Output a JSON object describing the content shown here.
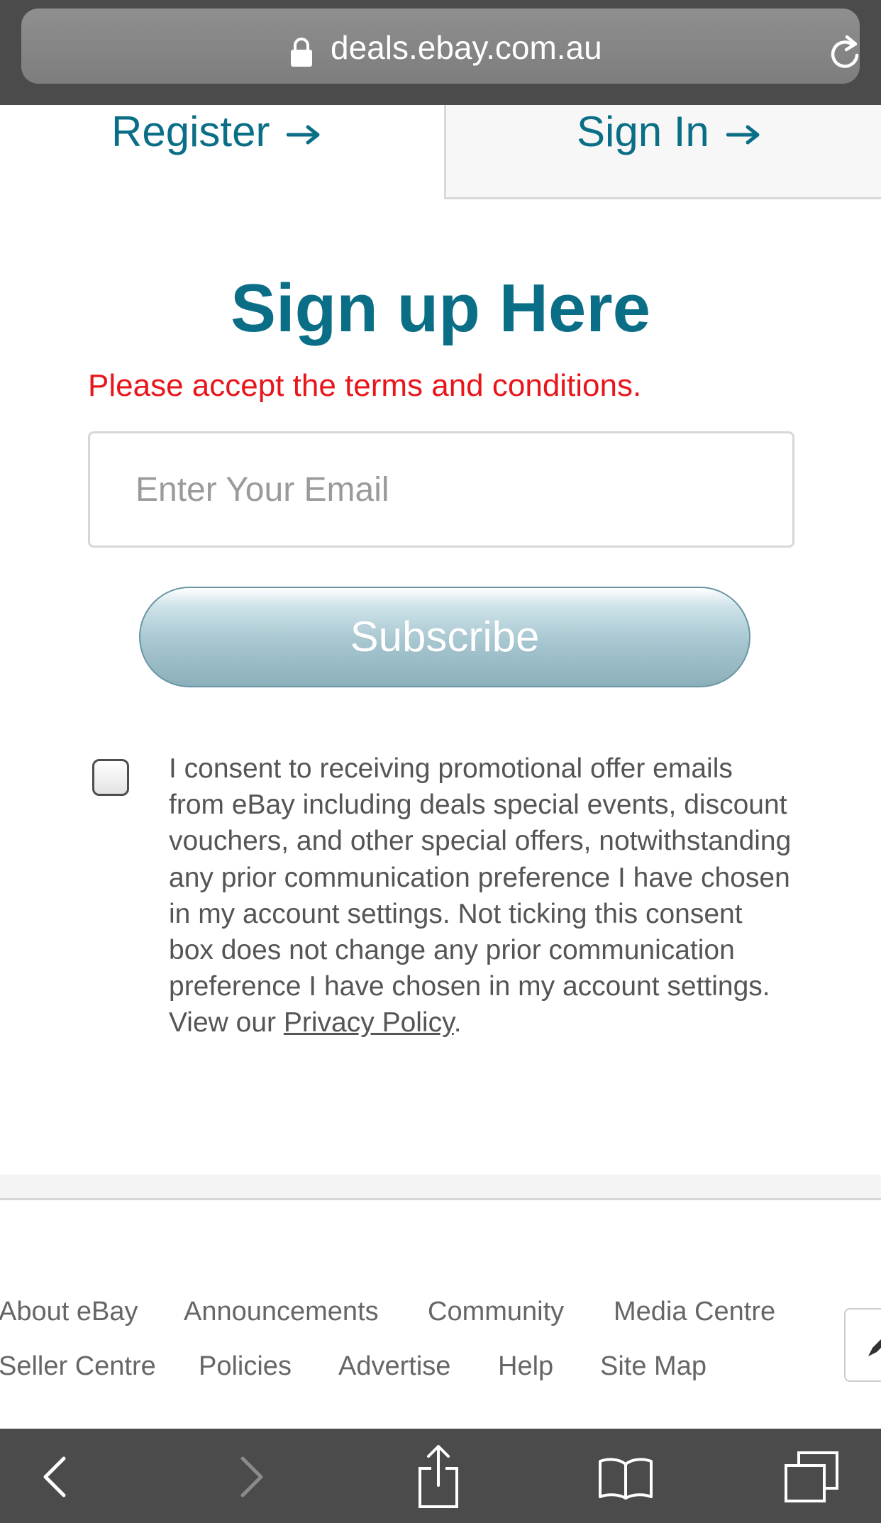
{
  "browser": {
    "url": "deals.ebay.com.au",
    "icons": [
      "lock-icon",
      "reload-icon"
    ],
    "toolbar_icons": [
      "back-icon",
      "forward-icon",
      "share-icon",
      "bookmarks-icon",
      "tabs-icon"
    ]
  },
  "tabs": {
    "register_label": "Register",
    "signin_label": "Sign In"
  },
  "main": {
    "heading": "Sign up Here",
    "error": "Please accept the terms and conditions.",
    "email_placeholder": "Enter Your Email",
    "subscribe_label": "Subscribe",
    "consent_text": "I consent to receiving promotional offer emails from eBay including deals special events, discount vouchers, and other special offers, notwithstanding any prior communication preference I have chosen in my account settings. Not ticking this consent box does not change any prior communication preference I have chosen in my account settings. View our ",
    "privacy_link": "Privacy Policy",
    "consent_end": ".",
    "consent_checked": false
  },
  "footer": {
    "row1": [
      "About eBay",
      "Announcements",
      "Community",
      "Media Centre"
    ],
    "row2": [
      "Seller Centre",
      "Policies",
      "Advertise",
      "Help",
      "Site Map"
    ]
  },
  "colors": {
    "brand_teal": "#0a6e86",
    "error_red": "#e8151b",
    "browser_chrome": "#4b4b4b"
  }
}
